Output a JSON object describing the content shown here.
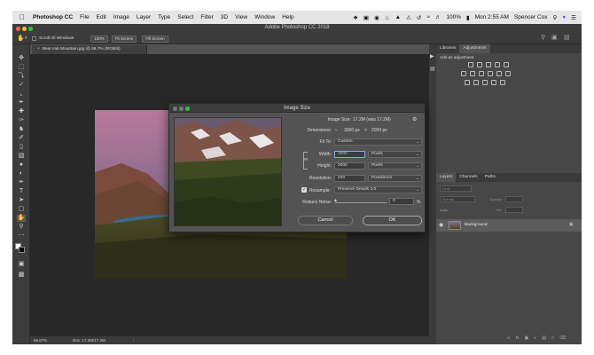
{
  "menubar": {
    "apple": "",
    "app_name": "Photoshop CC",
    "menus": [
      "File",
      "Edit",
      "Image",
      "Layer",
      "Type",
      "Select",
      "Filter",
      "3D",
      "View",
      "Window",
      "Help"
    ],
    "status_extra": "100%",
    "clock": "Mon 2:55 AM",
    "user": "Spencer Cox"
  },
  "window": {
    "title": "Adobe Photoshop CC 2018",
    "options": {
      "scroll_all_windows": "Scroll All Windows",
      "zoom_100": "100%",
      "fit_screen": "Fit Screen",
      "fill_screen": "Fill Screen"
    },
    "document_tab": "Bear Hat Mountain.jpg @ 66.7% (RGB/8)",
    "status": {
      "zoom": "66.67%",
      "doc": "Doc: 17.2M/17.2M"
    }
  },
  "panels": {
    "top_tabs": [
      "Libraries",
      "Adjustments"
    ],
    "adjustments_hint": "Add an adjustment",
    "layer_tabs": [
      "Layers",
      "Channels",
      "Paths"
    ],
    "layer_kind": "Kind",
    "blend_mode": "Normal",
    "opacity_label": "Opacity:",
    "lock_label": "Lock:",
    "fill_label": "Fill:",
    "background_layer": "Background"
  },
  "dialog": {
    "title": "Image Size",
    "image_size_label": "Image Size:",
    "image_size_value": "17.2M (was 17.2M)",
    "dimensions_label": "Dimensions:",
    "dim_width": "3000 px",
    "dim_x": "×",
    "dim_height": "2000 px",
    "fit_to_label": "Fit To:",
    "fit_to_value": "Custom",
    "width_label": "Width:",
    "width_value": "3000",
    "width_unit": "Pixels",
    "height_label": "Height:",
    "height_value": "2000",
    "height_unit": "Pixels",
    "resolution_label": "Resolution:",
    "resolution_value": "240",
    "resolution_unit": "Pixels/Inch",
    "resample_label": "Resample:",
    "resample_value": "Preserve Details 2.0",
    "reduce_noise_label": "Reduce Noise:",
    "reduce_noise_value": "0",
    "reduce_noise_unit": "%",
    "cancel": "Cancel",
    "ok": "OK"
  }
}
